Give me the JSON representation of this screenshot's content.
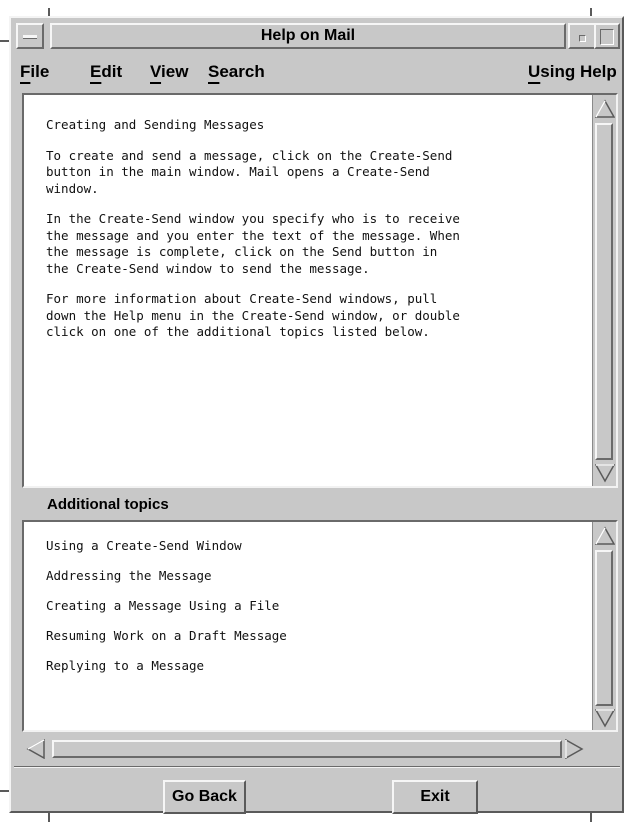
{
  "window": {
    "title": "Help on Mail"
  },
  "menubar": {
    "items": [
      {
        "label": "File",
        "mnemonic": "F",
        "rest": "ile"
      },
      {
        "label": "Edit",
        "mnemonic": "E",
        "rest": "dit"
      },
      {
        "label": "View",
        "mnemonic": "V",
        "rest": "iew"
      },
      {
        "label": "Search",
        "mnemonic": "S",
        "rest": "earch"
      }
    ],
    "help": {
      "label": "Using Help",
      "mnemonic": "U",
      "rest": "sing Help"
    }
  },
  "help_text": {
    "paragraphs": [
      "Creating and Sending Messages",
      "To create and send a message, click on the Create-Send\nbutton in the main window. Mail opens a Create-Send\nwindow.",
      "In the Create-Send window you specify who is to receive\nthe message and you enter the text of the message. When\nthe message is complete, click on the Send button in\nthe Create-Send window to send the message.",
      "For more information about Create-Send windows, pull\ndown the Help menu in the Create-Send window, or double\nclick on one of the additional topics listed below."
    ]
  },
  "additional_topics": {
    "heading": "Additional topics",
    "items": [
      "Using a Create-Send Window",
      "Addressing the Message",
      "Creating a Message Using a File",
      "Resuming Work on a Draft Message",
      "Replying to a Message"
    ]
  },
  "buttons": {
    "go_back": "Go Back",
    "exit": "Exit"
  },
  "icons": {
    "window_menu": "window-menu-icon",
    "minimize": "minimize-icon",
    "maximize": "maximize-icon",
    "scroll_up": "triangle-up-icon",
    "scroll_down": "triangle-down-icon",
    "scroll_left": "triangle-left-icon",
    "scroll_right": "triangle-right-icon"
  }
}
